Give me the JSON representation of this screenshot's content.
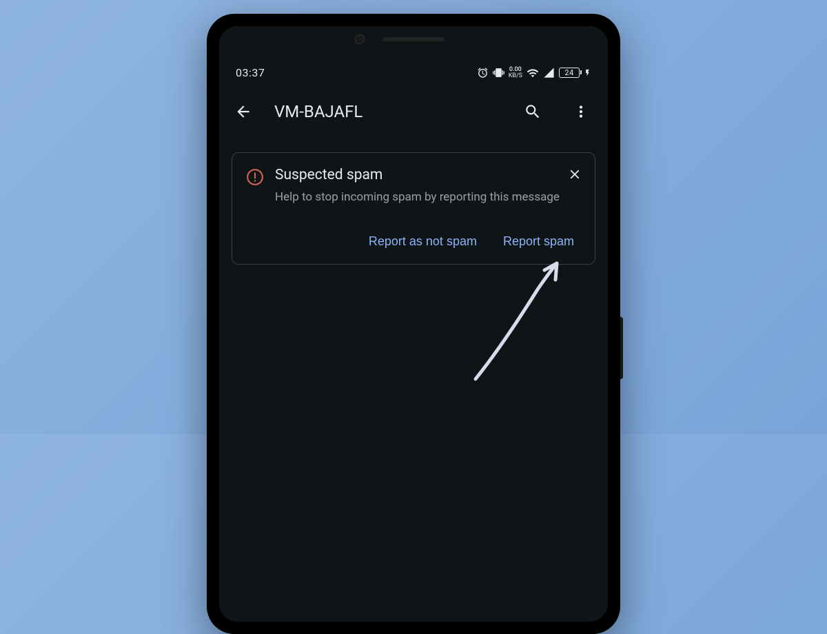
{
  "status": {
    "time": "03:37",
    "net_speed_value": "0.00",
    "net_speed_unit": "KB/S",
    "battery_pct": "24"
  },
  "header": {
    "title": "VM-BAJAFL"
  },
  "card": {
    "title": "Suspected spam",
    "body": "Help to stop incoming spam by reporting this message",
    "not_spam_label": "Report as not spam",
    "spam_label": "Report spam"
  },
  "colors": {
    "accent": "#8ab4f8",
    "warn": "#d16154"
  }
}
